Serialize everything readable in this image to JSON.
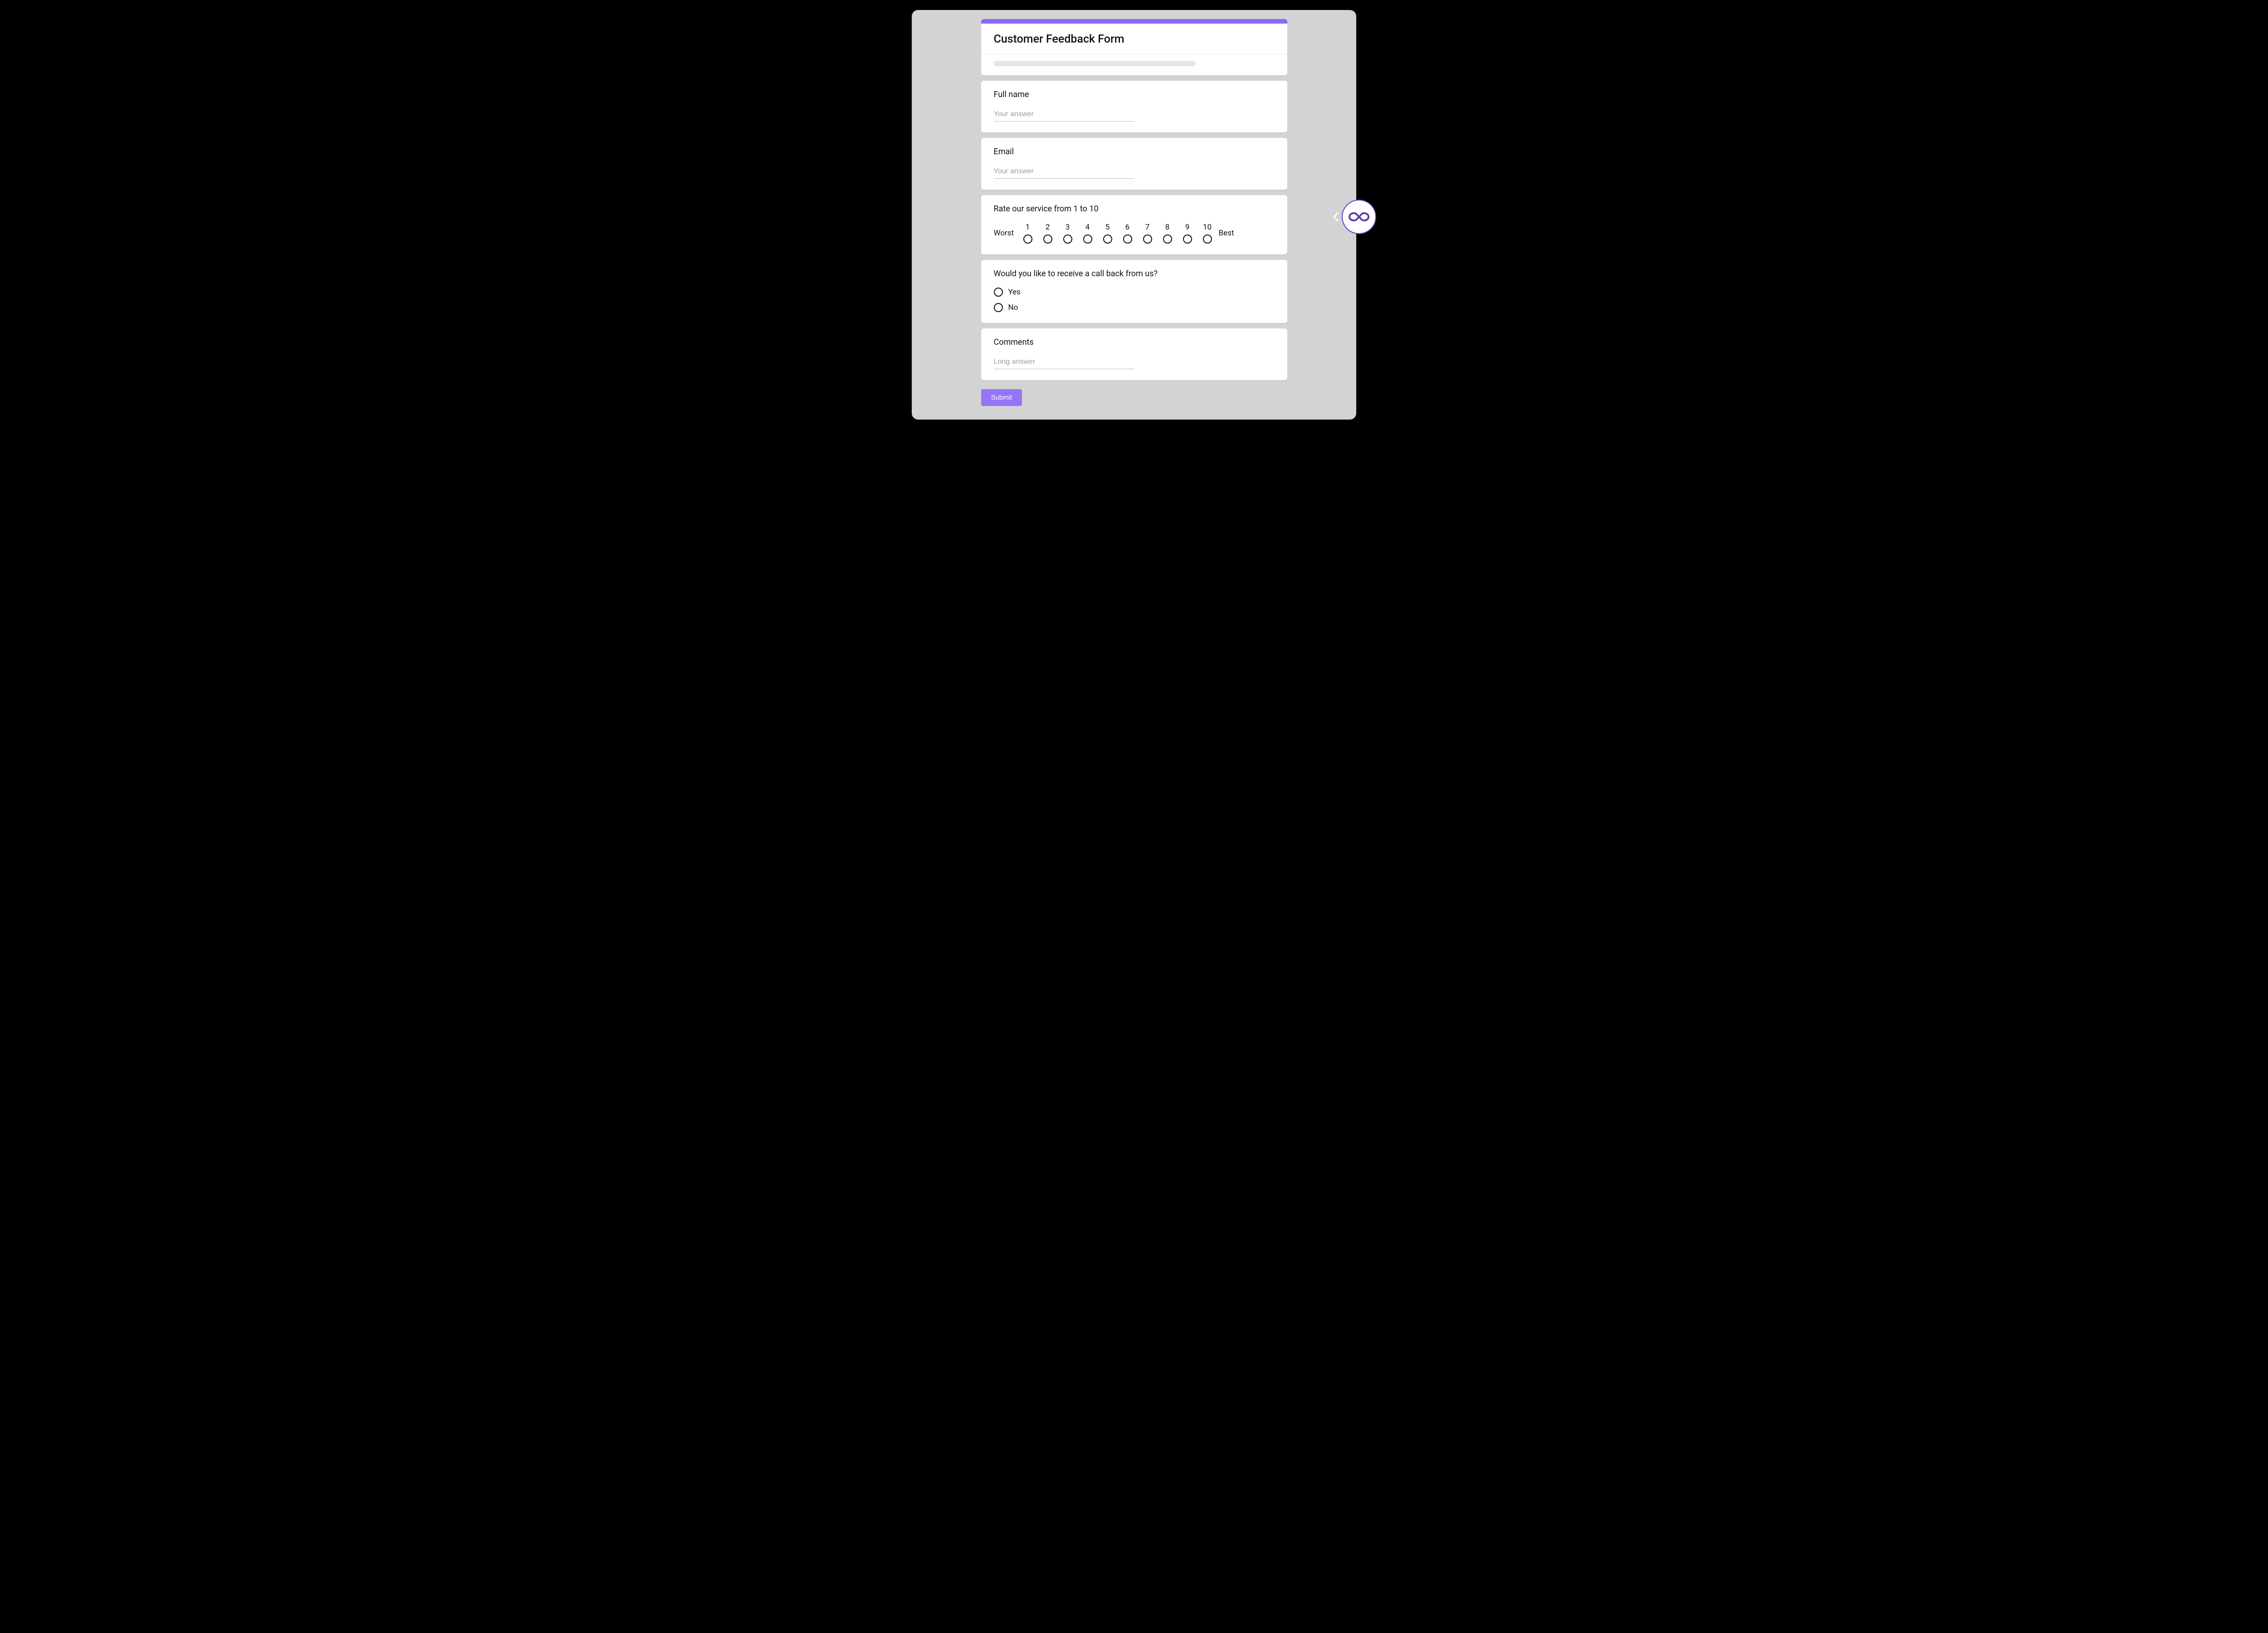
{
  "accent_color": "#8c66f7",
  "header": {
    "title": "Customer Feedback Form"
  },
  "questions": {
    "fullname": {
      "label": "Full name",
      "placeholder": "Your answer"
    },
    "email": {
      "label": "Email",
      "placeholder": "Your answer"
    },
    "rating": {
      "label": "Rate our service from 1 to 10",
      "low_label": "Worst",
      "high_label": "Best",
      "options": [
        "1",
        "2",
        "3",
        "4",
        "5",
        "6",
        "7",
        "8",
        "9",
        "10"
      ]
    },
    "callback": {
      "label": "Would you like to receive a call back from us?",
      "options": [
        "Yes",
        "No"
      ]
    },
    "comments": {
      "label": "Comments",
      "placeholder": "Long answer"
    }
  },
  "submit_label": "Submit",
  "widget": {
    "icon": "infinity-icon"
  }
}
